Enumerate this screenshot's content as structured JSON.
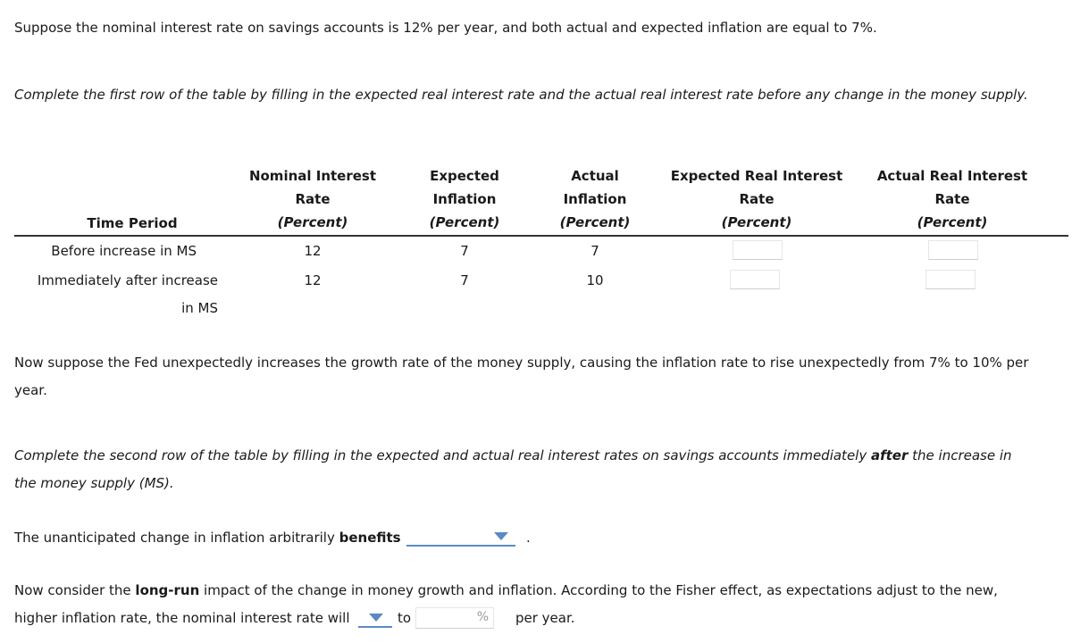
{
  "intro": {
    "text": "Suppose the nominal interest rate on savings accounts is 12% per year, and both actual and expected inflation are equal to 7%."
  },
  "instruction_row1": {
    "text": "Complete the first row of the table by filling in the expected real interest rate and the actual real interest rate before any change in the money supply."
  },
  "table": {
    "headers": {
      "time_period": "Time Period",
      "nominal": [
        "Nominal Interest",
        "Rate",
        "(Percent)"
      ],
      "expected_inflation": [
        "Expected",
        "Inflation",
        "(Percent)"
      ],
      "actual_inflation": [
        "Actual",
        "Inflation",
        "(Percent)"
      ],
      "expected_real": [
        "Expected Real Interest",
        "Rate",
        "(Percent)"
      ],
      "actual_real": [
        "Actual Real Interest",
        "Rate",
        "(Percent)"
      ]
    },
    "rows": [
      {
        "label": "Before increase in MS",
        "label_line2": "",
        "nominal": "12",
        "expected_inflation": "7",
        "actual_inflation": "7",
        "expected_real": "",
        "actual_real": ""
      },
      {
        "label": "Immediately after increase",
        "label_line2": "in MS",
        "nominal": "12",
        "expected_inflation": "7",
        "actual_inflation": "10",
        "expected_real": "",
        "actual_real": ""
      }
    ]
  },
  "fed_paragraph": {
    "line1": "Now suppose the Fed unexpectedly increases the growth rate of the money supply, causing the inflation rate to rise unexpectedly from 7% to 10% per",
    "line2": "year."
  },
  "instruction_row2": {
    "line1_pre": "Complete the second row of the table by filling in the expected and actual real interest rates on savings accounts immediately ",
    "line1_bold": "after",
    "line1_post": " the increase in",
    "line2": "the money supply (MS)."
  },
  "benefits_question": {
    "pre": "The unanticipated change in inflation arbitrarily ",
    "bold": "benefits",
    "selected": "",
    "post": "."
  },
  "long_run": {
    "line1_pre": "Now consider the ",
    "line1_bold": "long-run",
    "line1_post": " impact of the change in money growth and inflation. According to the Fisher effect, as expectations adjust to the new,",
    "line2_pre": "higher inflation rate, the nominal interest rate will",
    "dropdown_selected": "",
    "to_label": "to",
    "input_value": "",
    "input_suffix": "%",
    "post": "per year."
  },
  "colors": {
    "accent": "#5b8ac4",
    "text": "#1a1a1a",
    "rule": "#333333"
  }
}
